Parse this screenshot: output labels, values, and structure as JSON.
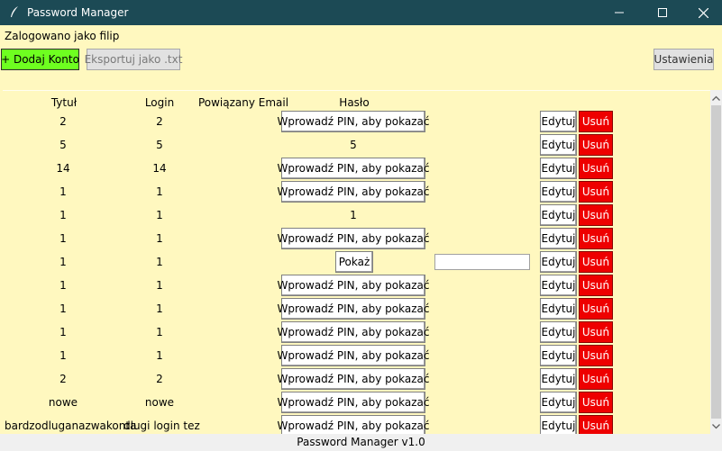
{
  "window": {
    "title": "Password Manager",
    "minimize_icon": "minimize-icon",
    "maximize_icon": "maximize-icon",
    "close_icon": "close-icon"
  },
  "login_info": "Zalogowano jako filip",
  "toolbar": {
    "add_label": "+ Dodaj Konto",
    "export_label": "Eksportuj jako .txt",
    "settings_label": "Ustawienia"
  },
  "columns": [
    "Tytuł",
    "Login",
    "Powiązany Email",
    "Hasło"
  ],
  "accounts": [
    {
      "title": "2",
      "login": "2",
      "email": "",
      "password": {
        "mode": "button",
        "text": "Wprowadź PIN, aby pokazać"
      }
    },
    {
      "title": "5",
      "login": "5",
      "email": "",
      "password": {
        "mode": "text",
        "text": "5"
      }
    },
    {
      "title": "14",
      "login": "14",
      "email": "",
      "password": {
        "mode": "button",
        "text": "Wprowadź PIN, aby pokazać"
      }
    },
    {
      "title": "1",
      "login": "1",
      "email": "",
      "password": {
        "mode": "button",
        "text": "Wprowadź PIN, aby pokazać"
      }
    },
    {
      "title": "1",
      "login": "1",
      "email": "",
      "password": {
        "mode": "text",
        "text": "1"
      }
    },
    {
      "title": "1",
      "login": "1",
      "email": "",
      "password": {
        "mode": "button",
        "text": "Wprowadź PIN, aby pokazać"
      }
    },
    {
      "title": "1",
      "login": "1",
      "email": "",
      "password": {
        "mode": "pin",
        "text": "Pokaż",
        "pin_value": ""
      }
    },
    {
      "title": "1",
      "login": "1",
      "email": "",
      "password": {
        "mode": "button",
        "text": "Wprowadź PIN, aby pokazać"
      }
    },
    {
      "title": "1",
      "login": "1",
      "email": "",
      "password": {
        "mode": "button",
        "text": "Wprowadź PIN, aby pokazać"
      }
    },
    {
      "title": "1",
      "login": "1",
      "email": "",
      "password": {
        "mode": "button",
        "text": "Wprowadź PIN, aby pokazać"
      }
    },
    {
      "title": "1",
      "login": "1",
      "email": "",
      "password": {
        "mode": "button",
        "text": "Wprowadź PIN, aby pokazać"
      }
    },
    {
      "title": "2",
      "login": "2",
      "email": "",
      "password": {
        "mode": "button",
        "text": "Wprowadź PIN, aby pokazać"
      }
    },
    {
      "title": "nowe",
      "login": "nowe",
      "email": "",
      "password": {
        "mode": "button",
        "text": "Wprowadź PIN, aby pokazać"
      }
    },
    {
      "title": "bardzodluganazwakonta",
      "login": "dlugi login tez",
      "email": "",
      "password": {
        "mode": "button",
        "text": "Wprowadź PIN, aby pokazać"
      }
    }
  ],
  "row_actions": {
    "edit_label": "Edytuj",
    "delete_label": "Usuń"
  },
  "footer": "Password Manager v1.0",
  "colors": {
    "titlebar": "#1c4a55",
    "background": "#fff8bf",
    "add_button": "#6eff20",
    "delete_button": "#ee0000"
  }
}
